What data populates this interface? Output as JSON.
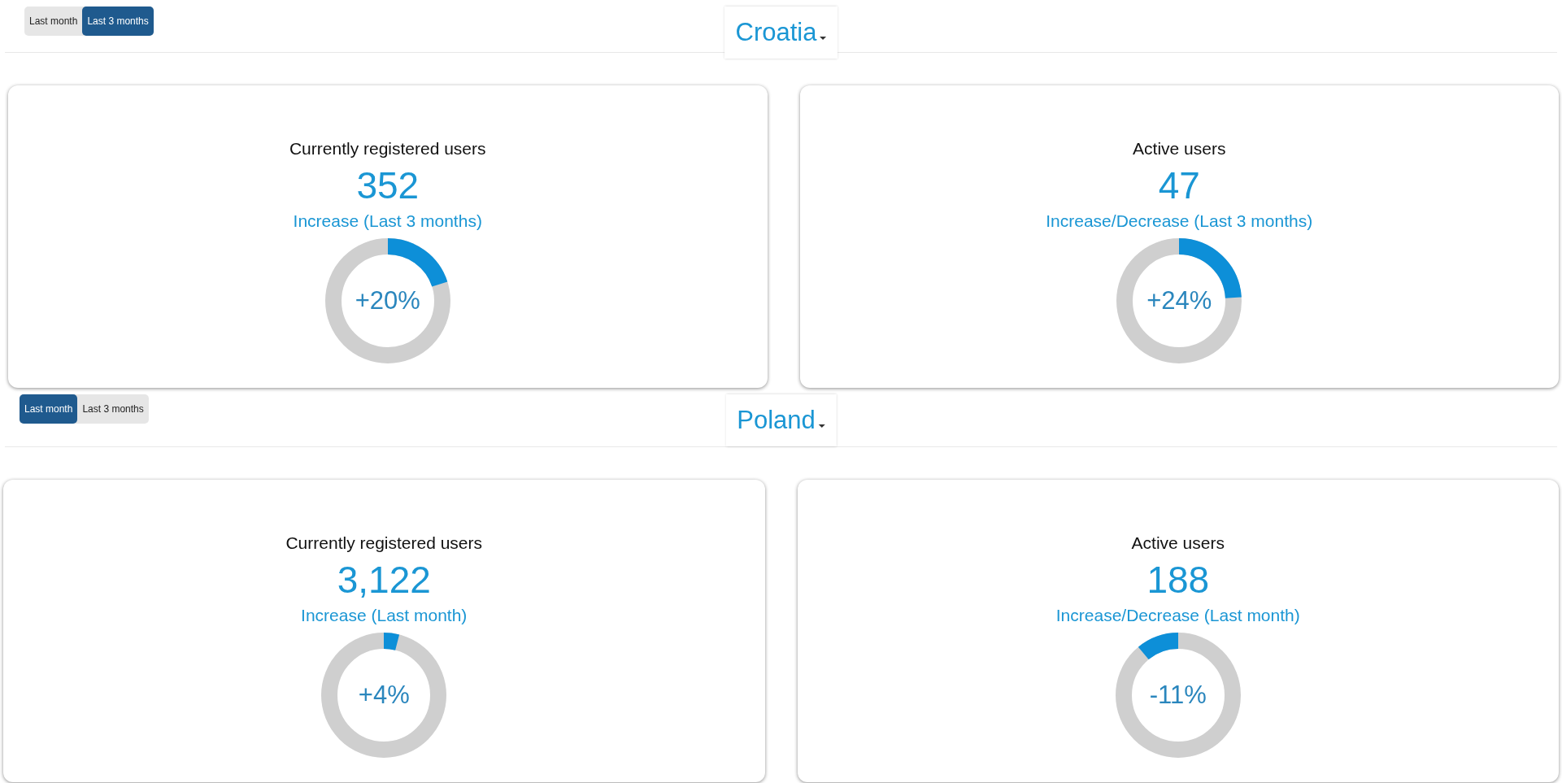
{
  "sections": [
    {
      "periods": [
        {
          "label": "Last month",
          "selected": false
        },
        {
          "label": "Last 3 months",
          "selected": true
        }
      ],
      "country": "Croatia",
      "cards": [
        {
          "title": "Currently registered users",
          "value": "352",
          "subtitle": "Increase (Last 3 months)",
          "change": "+20%",
          "kind": "increase",
          "level": 0.2
        },
        {
          "title": "Active users",
          "value": "47",
          "subtitle": "Increase/Decrease (Last 3 months)",
          "change": "+24%",
          "kind": "increase",
          "level": 0.24
        }
      ]
    },
    {
      "periods": [
        {
          "label": "Last month",
          "selected": true
        },
        {
          "label": "Last 3 months",
          "selected": false
        }
      ],
      "country": "Poland",
      "cards": [
        {
          "title": "Currently registered users",
          "value": "3,122",
          "subtitle": "Increase (Last month)",
          "change": "+4%",
          "kind": "increase",
          "level": 0.04
        },
        {
          "title": "Active users",
          "value": "188",
          "subtitle": "Increase/Decrease (Last month)",
          "change": "-11%",
          "kind": "decrease",
          "level": 0.11
        }
      ]
    }
  ]
}
